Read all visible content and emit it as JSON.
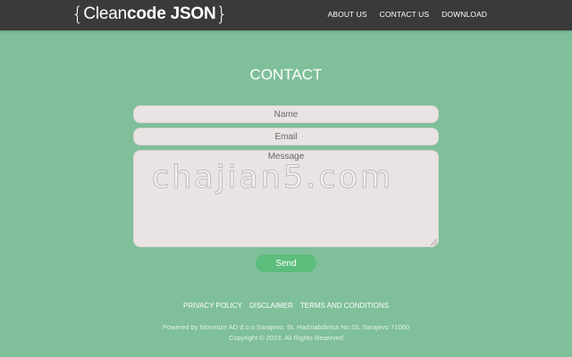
{
  "header": {
    "logo": {
      "open_brace": "{",
      "light_text": "Clean",
      "bold_text": "code",
      "bold_text_2": "JSON",
      "close_brace": "}"
    },
    "nav": [
      "ABOUT US",
      "CONTACT US",
      "DOWNLOAD"
    ]
  },
  "main": {
    "title": "CONTACT",
    "form": {
      "name_placeholder": "Name",
      "email_placeholder": "Email",
      "message_placeholder": "Message",
      "send_label": "Send"
    }
  },
  "watermark": "chajian5.com",
  "footer": {
    "links": [
      "PRIVACY POLICY",
      "DISCLAIMER",
      "TERMS AND CONDITIONS"
    ],
    "powered": "Powered by Monetize AD d.o.o Sarajevo, St. Hadziabdinica No.15, Sarajevo 71000",
    "copyright": "Copyright © 2023. All Rights Reserved"
  },
  "colors": {
    "background": "#7fbf9a",
    "topbar": "#3a3a3a",
    "field": "#e9e4e3",
    "send_button": "#5cbd7c"
  }
}
